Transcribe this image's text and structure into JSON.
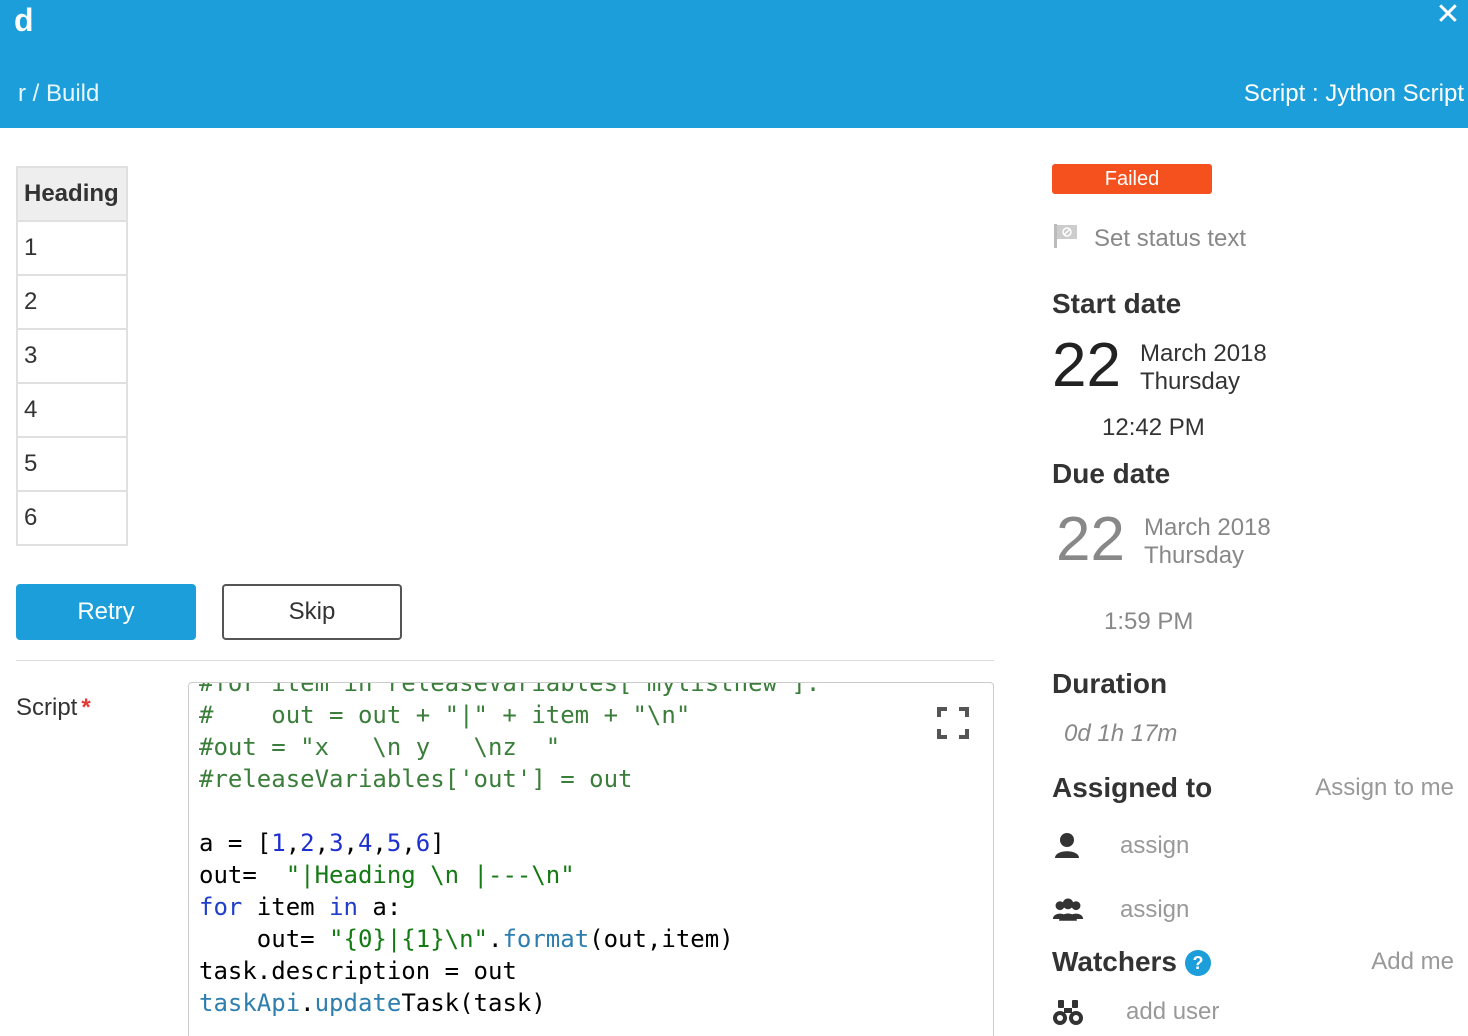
{
  "header": {
    "title": "d",
    "breadcrumb": "r / Build",
    "task_type": "Script : Jython Script",
    "close_icon": "close-icon"
  },
  "description_table": {
    "header": "Heading",
    "rows": [
      "1",
      "2",
      "3",
      "4",
      "5",
      "6"
    ]
  },
  "actions": {
    "retry_label": "Retry",
    "skip_label": "Skip"
  },
  "script": {
    "label": "Script",
    "required_mark": "*",
    "lines": [
      "#for item in releaseVariables['mylistnew']:",
      "#    out = out + \"|\" + item + \"\\n\"",
      "#out = \"x   \\n y   \\nz  \"",
      "#releaseVariables['out'] = out",
      "",
      "a = [1,2,3,4,5,6]",
      "out=  \"|Heading \\n |---\\n\"",
      "for item in a:",
      "    out= \"{0}|{1}\\n\".format(out,item)",
      "task.description = out",
      "taskApi.updateTask(task)"
    ]
  },
  "sidebar": {
    "status": "Failed",
    "status_color": "#f4511e",
    "set_status_text": "Set status text",
    "start_date": {
      "label": "Start date",
      "day": "22",
      "month_year": "March 2018",
      "weekday": "Thursday",
      "time": "12:42 PM"
    },
    "due_date": {
      "label": "Due date",
      "day": "22",
      "month_year": "March 2018",
      "weekday": "Thursday",
      "time": "1:59 PM"
    },
    "duration": {
      "label": "Duration",
      "value": "0d 1h 17m"
    },
    "assigned_to": {
      "label": "Assigned to",
      "assign_to_me": "Assign to me",
      "user_assign": "assign",
      "team_assign": "assign"
    },
    "watchers": {
      "label": "Watchers",
      "help": "?",
      "add_me": "Add me",
      "add_user": "add user"
    }
  },
  "colors": {
    "header_bg": "#1b9ed9",
    "primary": "#1b9ed9"
  }
}
